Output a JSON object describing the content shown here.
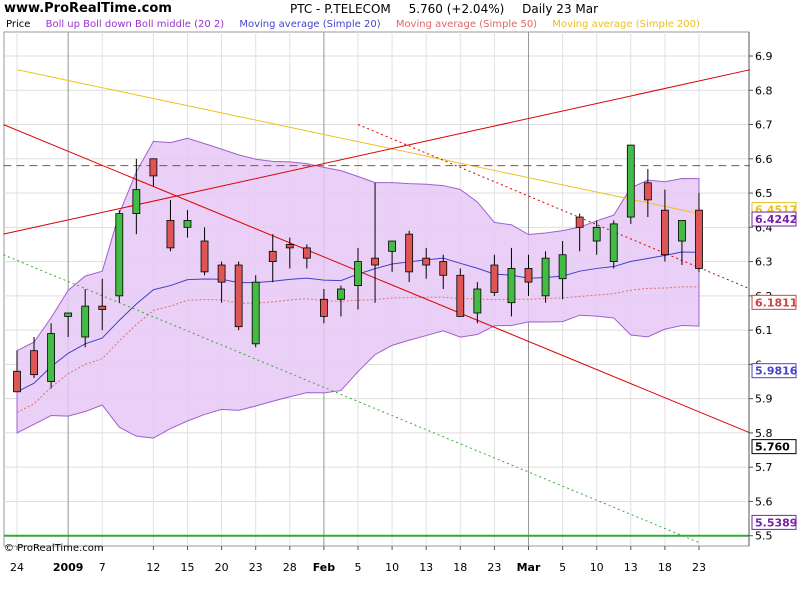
{
  "site": "www.ProRealTime.com",
  "header": {
    "symbol": "PTC - P.TELECOM",
    "quote": "5.760 (+2.04%)",
    "period": "Daily  23 Mar"
  },
  "legend": [
    {
      "text": "Price",
      "color": "#000000"
    },
    {
      "text": "Boll up Boll down Boll middle (20 2)",
      "color": "#9933cc"
    },
    {
      "text": "Moving average (Simple 20)",
      "color": "#4444cc"
    },
    {
      "text": "Moving average (Simple 50)",
      "color": "#dd6666"
    },
    {
      "text": "Moving average (Simple 200)",
      "color": "#e8c020"
    }
  ],
  "copyright": "© ProRealTime.com",
  "colors": {
    "up": "#44bb44",
    "down": "#dd5555",
    "band_fill": "#e6c8f6",
    "band_line": "#a060d0",
    "ma20": "#4040cc",
    "ma50": "#e07070",
    "ma200": "#f0c020",
    "trend": "#dd0000",
    "support_green": "#33aa33"
  },
  "chart_data": {
    "type": "candlestick",
    "ylim": [
      5.47,
      6.97
    ],
    "y_ticks": [
      "6.9",
      "6.8",
      "6.7",
      "6.6",
      "6.5",
      "6.4",
      "6.3",
      "6.2",
      "6.1",
      "6",
      "5.9",
      "5.8",
      "5.7",
      "5.6",
      "5.5"
    ],
    "x_ticks": [
      "24",
      "2009",
      "7",
      "12",
      "15",
      "20",
      "23",
      "28",
      "Feb",
      "5",
      "10",
      "13",
      "18",
      "23",
      "Mar",
      "5",
      "10",
      "13",
      "18",
      "23"
    ],
    "x_tick_index": [
      0,
      3,
      5,
      8,
      10,
      12,
      14,
      16,
      18,
      20,
      22,
      24,
      26,
      28,
      30,
      32,
      34,
      36,
      38,
      40
    ],
    "month_markers": [
      3,
      18,
      30
    ],
    "candles": [
      {
        "o": 5.98,
        "h": 6.04,
        "l": 5.92,
        "c": 5.92
      },
      {
        "o": 6.04,
        "h": 6.08,
        "l": 5.96,
        "c": 5.97
      },
      {
        "o": 5.95,
        "h": 6.12,
        "l": 5.93,
        "c": 6.09
      },
      {
        "o": 6.14,
        "h": 6.15,
        "l": 6.08,
        "c": 6.15
      },
      {
        "o": 6.08,
        "h": 6.22,
        "l": 6.05,
        "c": 6.17
      },
      {
        "o": 6.17,
        "h": 6.25,
        "l": 6.1,
        "c": 6.16
      },
      {
        "o": 6.2,
        "h": 6.45,
        "l": 6.18,
        "c": 6.44
      },
      {
        "o": 6.44,
        "h": 6.6,
        "l": 6.38,
        "c": 6.51
      },
      {
        "o": 6.6,
        "h": 6.6,
        "l": 6.52,
        "c": 6.55
      },
      {
        "o": 6.42,
        "h": 6.48,
        "l": 6.33,
        "c": 6.34
      },
      {
        "o": 6.4,
        "h": 6.45,
        "l": 6.37,
        "c": 6.42
      },
      {
        "o": 6.36,
        "h": 6.4,
        "l": 6.26,
        "c": 6.27
      },
      {
        "o": 6.29,
        "h": 6.3,
        "l": 6.18,
        "c": 6.24
      },
      {
        "o": 6.29,
        "h": 6.3,
        "l": 6.1,
        "c": 6.11
      },
      {
        "o": 6.06,
        "h": 6.26,
        "l": 6.05,
        "c": 6.24
      },
      {
        "o": 6.33,
        "h": 6.38,
        "l": 6.24,
        "c": 6.3
      },
      {
        "o": 6.35,
        "h": 6.37,
        "l": 6.28,
        "c": 6.34
      },
      {
        "o": 6.34,
        "h": 6.35,
        "l": 6.28,
        "c": 6.31
      },
      {
        "o": 6.19,
        "h": 6.22,
        "l": 6.12,
        "c": 6.14
      },
      {
        "o": 6.19,
        "h": 6.23,
        "l": 6.14,
        "c": 6.22
      },
      {
        "o": 6.23,
        "h": 6.34,
        "l": 6.16,
        "c": 6.3
      },
      {
        "o": 6.31,
        "h": 6.53,
        "l": 6.18,
        "c": 6.29
      },
      {
        "o": 6.33,
        "h": 6.36,
        "l": 6.27,
        "c": 6.36
      },
      {
        "o": 6.38,
        "h": 6.39,
        "l": 6.24,
        "c": 6.27
      },
      {
        "o": 6.31,
        "h": 6.34,
        "l": 6.25,
        "c": 6.29
      },
      {
        "o": 6.3,
        "h": 6.32,
        "l": 6.22,
        "c": 6.26
      },
      {
        "o": 6.26,
        "h": 6.28,
        "l": 6.14,
        "c": 6.14
      },
      {
        "o": 6.15,
        "h": 6.24,
        "l": 6.12,
        "c": 6.22
      },
      {
        "o": 6.29,
        "h": 6.32,
        "l": 6.2,
        "c": 6.21
      },
      {
        "o": 6.18,
        "h": 6.34,
        "l": 6.14,
        "c": 6.28
      },
      {
        "o": 6.28,
        "h": 6.32,
        "l": 6.2,
        "c": 6.24
      },
      {
        "o": 6.2,
        "h": 6.33,
        "l": 6.18,
        "c": 6.31
      },
      {
        "o": 6.25,
        "h": 6.36,
        "l": 6.19,
        "c": 6.32
      },
      {
        "o": 6.43,
        "h": 6.44,
        "l": 6.33,
        "c": 6.4
      },
      {
        "o": 6.36,
        "h": 6.42,
        "l": 6.32,
        "c": 6.4
      },
      {
        "o": 6.3,
        "h": 6.42,
        "l": 6.28,
        "c": 6.41
      },
      {
        "o": 6.43,
        "h": 6.64,
        "l": 6.41,
        "c": 6.64
      },
      {
        "o": 6.53,
        "h": 6.57,
        "l": 6.43,
        "c": 6.48
      },
      {
        "o": 6.45,
        "h": 6.51,
        "l": 6.3,
        "c": 6.32
      },
      {
        "o": 6.36,
        "h": 6.42,
        "l": 6.29,
        "c": 6.42
      },
      {
        "o": 6.45,
        "h": 6.5,
        "l": 6.27,
        "c": 6.28
      }
    ],
    "price_labels": [
      {
        "value": 6.4517,
        "label": "6.4517",
        "color": "#e8c020"
      },
      {
        "value": 6.4242,
        "label": "6.4242",
        "color": "#7722aa"
      },
      {
        "value": 6.1811,
        "label": "6.1811",
        "color": "#cc4444"
      },
      {
        "value": 5.9816,
        "label": "5.9816",
        "color": "#4444cc"
      },
      {
        "value": 5.76,
        "label": "5.760",
        "color": "#000000"
      },
      {
        "value": 5.5389,
        "label": "5.5389",
        "color": "#7722aa"
      }
    ]
  }
}
